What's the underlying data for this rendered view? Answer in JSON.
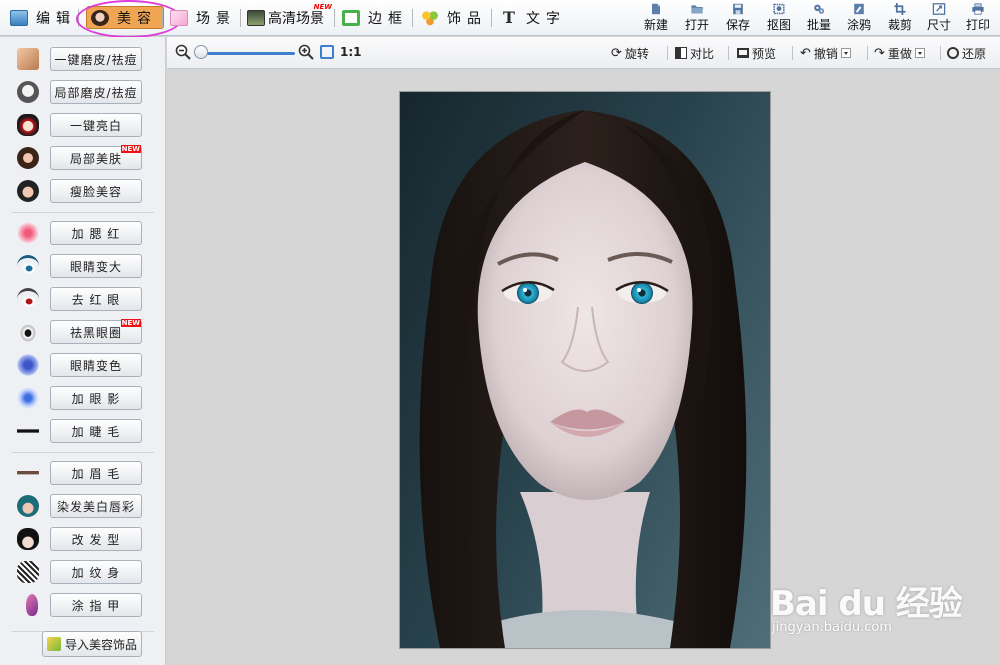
{
  "menubar": {
    "tabs": [
      {
        "label": "编辑",
        "icon": "image-edit-icon"
      },
      {
        "label": "美容",
        "icon": "beauty-face-icon",
        "active": true
      },
      {
        "label": "场景",
        "icon": "scene-icon"
      },
      {
        "label": "高清场景",
        "icon": "hd-scene-icon",
        "badge": "NEW"
      },
      {
        "label": "边框",
        "icon": "frame-icon"
      },
      {
        "label": "饰品",
        "icon": "ornament-icon"
      },
      {
        "label": "文字",
        "icon": "text-icon"
      }
    ],
    "tools": [
      {
        "label": "新建",
        "icon": "new-file-icon"
      },
      {
        "label": "打开",
        "icon": "open-folder-icon"
      },
      {
        "label": "保存",
        "icon": "save-disk-icon"
      },
      {
        "label": "抠图",
        "icon": "cutout-icon"
      },
      {
        "label": "批量",
        "icon": "batch-gear-icon"
      },
      {
        "label": "涂鸦",
        "icon": "doodle-icon"
      },
      {
        "label": "裁剪",
        "icon": "crop-icon"
      },
      {
        "label": "尺寸",
        "icon": "resize-icon"
      },
      {
        "label": "打印",
        "icon": "printer-icon"
      }
    ]
  },
  "leftpanel": {
    "items": [
      {
        "label": "一键磨皮/祛痘",
        "icon": "face-smooth-icon"
      },
      {
        "label": "局部磨皮/祛痘",
        "icon": "face-partial-smooth-icon"
      },
      {
        "label": "一键亮白",
        "icon": "opera-mask-icon"
      },
      {
        "label": "局部美肤",
        "icon": "skin-beauty-icon",
        "badge": "NEW"
      },
      {
        "label": "瘦脸美容",
        "icon": "slim-face-icon"
      },
      {
        "label": "加 腮 红",
        "icon": "blush-icon"
      },
      {
        "label": "眼睛变大",
        "icon": "eye-enlarge-icon"
      },
      {
        "label": "去 红 眼",
        "icon": "red-eye-icon"
      },
      {
        "label": "祛黑眼圈",
        "icon": "dark-circle-icon",
        "badge": "NEW"
      },
      {
        "label": "眼睛变色",
        "icon": "eye-color-icon"
      },
      {
        "label": "加 眼 影",
        "icon": "eye-shadow-icon"
      },
      {
        "label": "加 睫 毛",
        "icon": "eyelash-icon"
      },
      {
        "label": "加 眉 毛",
        "icon": "eyebrow-icon"
      },
      {
        "label": "染发美白唇彩",
        "icon": "hair-dye-icon"
      },
      {
        "label": "改 发 型",
        "icon": "hairstyle-icon"
      },
      {
        "label": "加 纹 身",
        "icon": "tattoo-dragon-icon"
      },
      {
        "label": "涂 指 甲",
        "icon": "nail-polish-icon"
      }
    ],
    "import_label": "导入美容饰品"
  },
  "toolbar2": {
    "ratio": "1:1",
    "rotate": "旋转",
    "compare": "对比",
    "preview": "预览",
    "undo": "撤销",
    "redo": "重做",
    "restore": "还原"
  },
  "watermark": {
    "main": "Bai du 经验",
    "sub": "jingyan.baidu.com"
  },
  "colors": {
    "active_tab": "#f0a552",
    "highlight_ring": "#e03bd8",
    "slider": "#3e7fd1",
    "canvas_bg": "#d6d6d6"
  }
}
